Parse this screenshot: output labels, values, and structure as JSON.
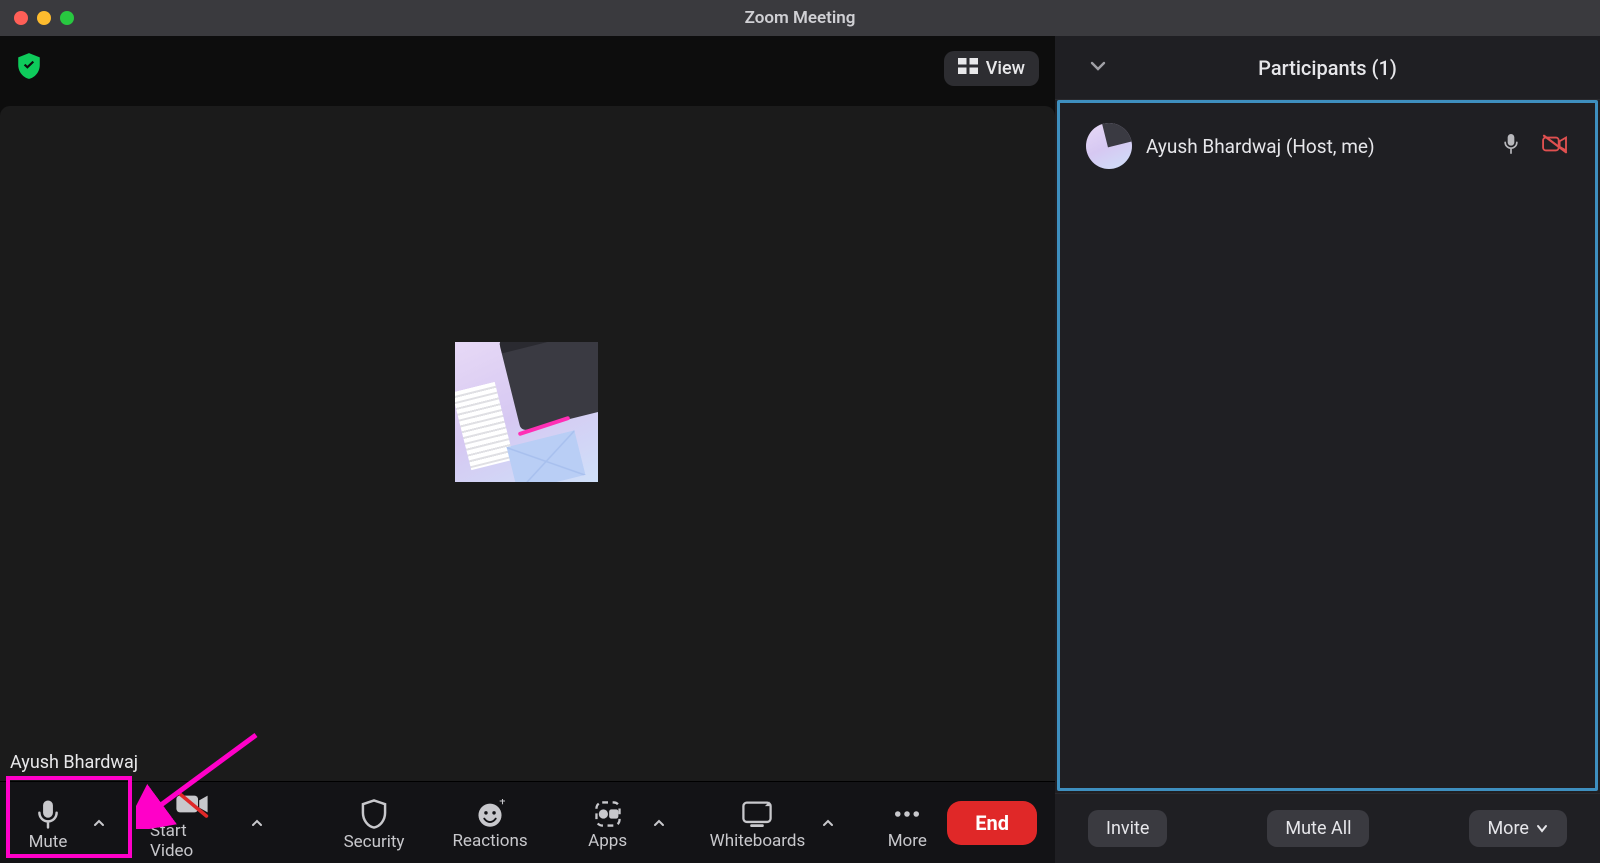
{
  "window": {
    "title": "Zoom Meeting"
  },
  "topbar": {
    "view_label": "View"
  },
  "video": {
    "display_name": "Ayush Bhardwaj"
  },
  "toolbar": {
    "mute_label": "Mute",
    "start_video_label": "Start Video",
    "security_label": "Security",
    "reactions_label": "Reactions",
    "apps_label": "Apps",
    "whiteboards_label": "Whiteboards",
    "more_label": "More",
    "end_label": "End"
  },
  "participants": {
    "header_label": "Participants (1)",
    "rows": [
      {
        "name": "Ayush Bhardwaj (Host, me)",
        "mic": "unmuted",
        "camera": "off"
      }
    ],
    "footer": {
      "invite_label": "Invite",
      "mute_all_label": "Mute All",
      "more_label": "More"
    }
  },
  "annotation": {
    "highlight_target": "mute-button"
  }
}
